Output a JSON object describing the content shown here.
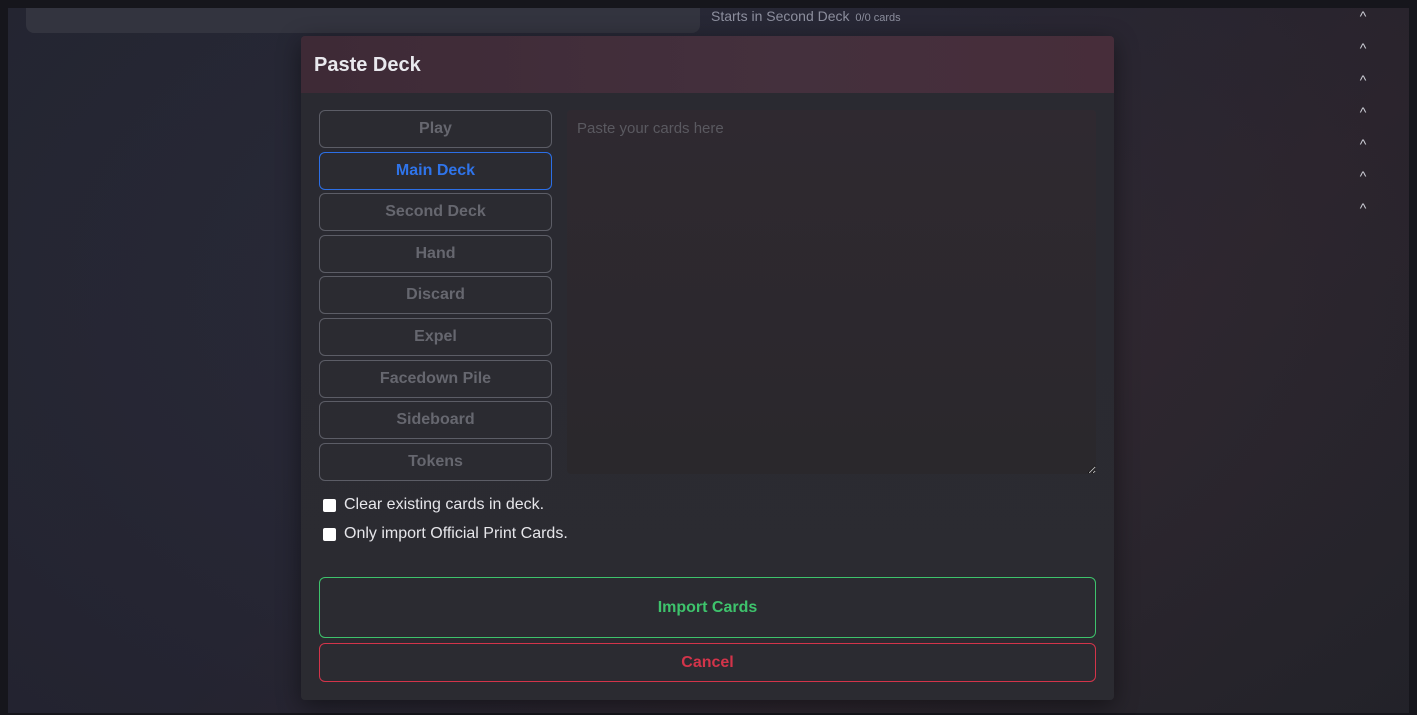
{
  "background": {
    "deck_status": {
      "label": "Starts in Second Deck",
      "count": "0/0 cards"
    },
    "chevrons": [
      "^",
      "^",
      "^",
      "^",
      "^",
      "^",
      "^"
    ]
  },
  "modal": {
    "title": "Paste Deck",
    "zones": [
      {
        "label": "Play",
        "active": false
      },
      {
        "label": "Main Deck",
        "active": true
      },
      {
        "label": "Second Deck",
        "active": false
      },
      {
        "label": "Hand",
        "active": false
      },
      {
        "label": "Discard",
        "active": false
      },
      {
        "label": "Expel",
        "active": false
      },
      {
        "label": "Facedown Pile",
        "active": false
      },
      {
        "label": "Sideboard",
        "active": false
      },
      {
        "label": "Tokens",
        "active": false
      }
    ],
    "paste_area": {
      "placeholder": "Paste your cards here",
      "value": ""
    },
    "options": [
      {
        "label": "Clear existing cards in deck.",
        "checked": false
      },
      {
        "label": "Only import Official Print Cards.",
        "checked": false
      }
    ],
    "import_label": "Import Cards",
    "cancel_label": "Cancel"
  },
  "colors": {
    "active_zone": "#2f74ea",
    "import": "#3ec36c",
    "cancel": "#d3344a",
    "header": "#44303d"
  }
}
